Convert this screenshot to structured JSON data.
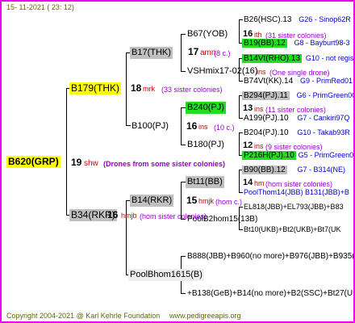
{
  "header": {
    "date": "15- 11-2021 ( 23: 12)"
  },
  "footer": {
    "copyright": "Copyright 2004-2021 @ Karl Kehrle Foundation",
    "site": "www.pedigreeapis.org"
  },
  "root": {
    "id": "B620(GRP)",
    "gen": "19",
    "suffix": "shw",
    "note": "(Drones from some sister colonies)"
  },
  "g1": [
    {
      "id": "B179(THK)",
      "gen": "18",
      "suffix": "mrk",
      "note": "(33 sister colonies)"
    },
    {
      "id": "B34(RKR)",
      "gen": "16",
      "suffix": "hmjb",
      "note": "(hom sister colonies)"
    }
  ],
  "g2": [
    {
      "id": "B17(THK)",
      "gen": "17",
      "suffix": "amn",
      "note": "(8 c.)"
    },
    {
      "id": "B100(PJ)",
      "gen": "16",
      "suffix": "ins",
      "note": "(10 c.)"
    },
    {
      "id": "B14(RKR)",
      "gen": "15",
      "suffix": "hmjk",
      "note": "(hom c.)"
    },
    {
      "id": "PoolBhom1615(B)"
    }
  ],
  "g3": [
    {
      "id": "B67(YOB)",
      "gen": "16",
      "suffix": "ith",
      "note": "(31 sister colonies)"
    },
    {
      "id": "VSHmix17-02(16)",
      "gen": "",
      "suffix": "ins",
      "note": "(One single drone)"
    },
    {
      "id": "B240(PJ)",
      "gen": "13",
      "suffix": "ins",
      "note": "(11 sister colonies)"
    },
    {
      "id": "B180(PJ)",
      "gen": "12",
      "suffix": "ins",
      "note": "(9 sister colonies)"
    },
    {
      "id": "Bt11(BB)",
      "gen": "14",
      "suffix": "hm",
      "note": "(hom sister colonies)"
    },
    {
      "id": "PoolB2hom15(13B)"
    },
    {
      "id": "B888(JBB)+B960(no more)+B976(JBB)+B935(JB"
    },
    {
      "id": "+B138(GeB)+B14(no more)+B2(SSC)+Bt27(UK"
    }
  ],
  "g4": [
    {
      "id": "B26(HSC).13",
      "info": "G26 - Sinop62R"
    },
    {
      "id": "B19(BB).12",
      "info": "G8 - Bayburt98-3"
    },
    {
      "id": "B14Vt(RHO).13",
      "info": "G10 - not registe"
    },
    {
      "id": "B74Vt(KK).14",
      "info": "G9 - PrimRed01"
    },
    {
      "id": "B294(PJ).11",
      "info": "G6 - PrimGreen00"
    },
    {
      "id": "A199(PJ).10",
      "info": "G7 - Cankiri97Q"
    },
    {
      "id": "B204(PJ).10",
      "info": "G10 - Takab93R"
    },
    {
      "id": "P216H(PJ).10",
      "info": "G5 - PrimGreen00"
    },
    {
      "id": "B90(BB).12",
      "info": "G7 - B314(NE)"
    },
    {
      "id": "PoolThom14(JBB)",
      "info": "B131(JBB)+B"
    },
    {
      "id": "EL818(JBB)+EL793(JBB)+B83",
      "info": ""
    },
    {
      "id": "Bt10(UKB)+Bt2(UKB)+Bt7(UK",
      "info": ""
    }
  ]
}
